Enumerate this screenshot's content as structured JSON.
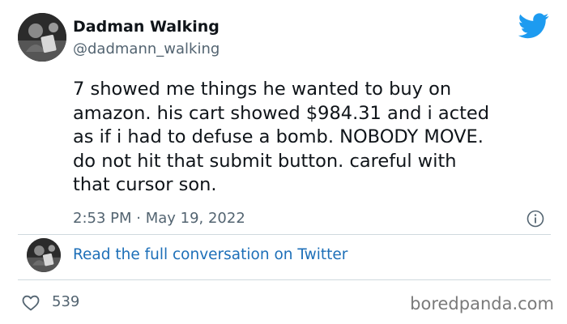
{
  "tweet": {
    "author_name": "Dadman Walking",
    "author_handle": "@dadmann_walking",
    "text": "7 showed me things he wanted to buy on\namazon. his cart showed $984.31 and i acted\nas if i had to defuse a bomb. NOBODY MOVE.\ndo not hit that submit button. careful with\nthat cursor son.",
    "timestamp": "2:53 PM · May 19, 2022",
    "conversation_link": "Read the full conversation on Twitter",
    "likes": "539"
  },
  "icons": {
    "brand": "twitter-bird-icon",
    "info": "info-icon",
    "like": "heart-icon"
  },
  "colors": {
    "twitter_blue": "#1d9bf0",
    "link_blue": "#1d6fb8",
    "secondary_text": "#536471"
  },
  "watermark": "boredpanda.com"
}
